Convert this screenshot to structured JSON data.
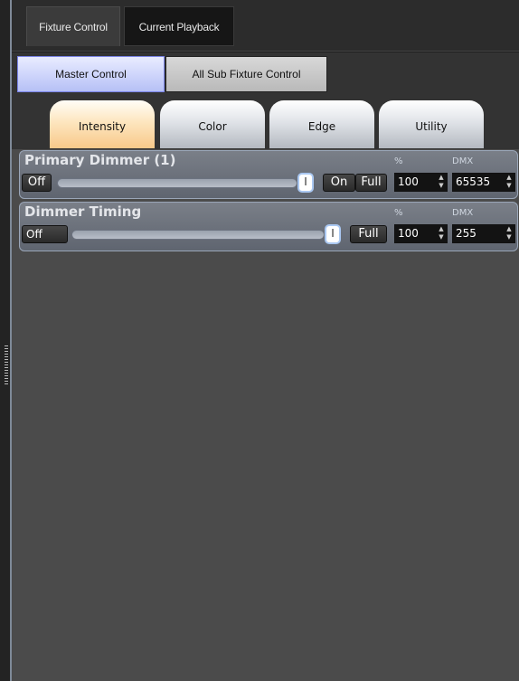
{
  "tabs": {
    "fixture_control": "Fixture Control",
    "current_playback": "Current Playback"
  },
  "subtabs": {
    "master_control": "Master Control",
    "all_sub_fixture_control": "All Sub Fixture Control"
  },
  "categories": [
    "Intensity",
    "Color",
    "Edge",
    "Utility"
  ],
  "params": [
    {
      "title": "Primary Dimmer (1)",
      "off": "Off",
      "thumb": "I",
      "on": "On",
      "full": "Full",
      "percent_label": "%",
      "dmx_label": "DMX",
      "percent_value": "100",
      "dmx_value": "65535",
      "level": 1.0
    },
    {
      "title": "Dimmer Timing",
      "off": "Off",
      "thumb": "I",
      "full": "Full",
      "percent_label": "%",
      "dmx_label": "DMX",
      "percent_value": "100",
      "dmx_value": "255",
      "level": 1.0
    }
  ],
  "spinner_arrows": {
    "up": "▲",
    "down": "▼"
  },
  "colors": {
    "active_subtab": "#cdd4fb",
    "active_category": "#f8c98a",
    "panel": "#6b7079",
    "slider_focus": "#aac8f2"
  }
}
